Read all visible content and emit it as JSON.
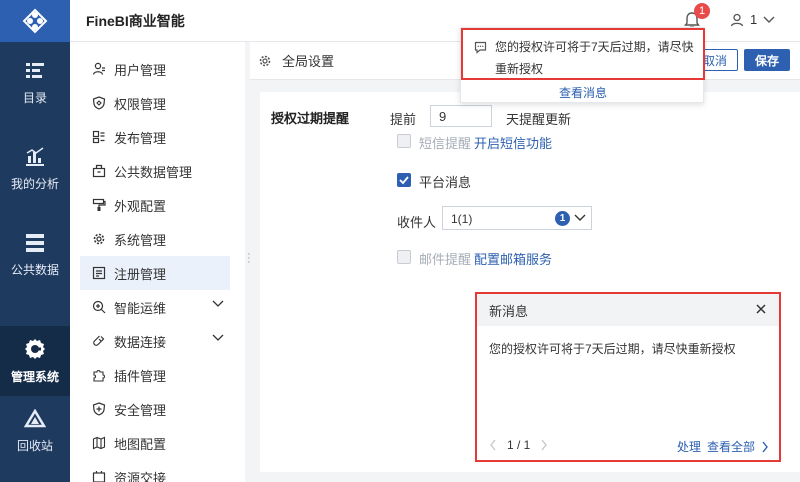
{
  "topbar": {
    "brand": "FineBI商业智能",
    "badge_count": "1",
    "user_name": "1"
  },
  "leftnav": [
    {
      "label": "目录",
      "icon": "catalog-icon"
    },
    {
      "label": "我的分析",
      "icon": "analysis-icon"
    },
    {
      "label": "公共数据",
      "icon": "public-data-icon"
    },
    {
      "label": "管理系统",
      "icon": "gear-icon",
      "active": true
    },
    {
      "label": "回收站",
      "icon": "recycle-icon"
    }
  ],
  "menu": [
    {
      "label": "用户管理",
      "icon": "user-icon"
    },
    {
      "label": "权限管理",
      "icon": "shield-icon"
    },
    {
      "label": "发布管理",
      "icon": "publish-icon"
    },
    {
      "label": "公共数据管理",
      "icon": "box-icon"
    },
    {
      "label": "外观配置",
      "icon": "brush-icon"
    },
    {
      "label": "系统管理",
      "icon": "gear-icon"
    },
    {
      "label": "注册管理",
      "icon": "register-icon",
      "active": true
    },
    {
      "label": "智能运维",
      "icon": "ops-icon",
      "expandable": true
    },
    {
      "label": "数据连接",
      "icon": "link-icon",
      "expandable": true
    },
    {
      "label": "插件管理",
      "icon": "puzzle-icon"
    },
    {
      "label": "安全管理",
      "icon": "security-icon"
    },
    {
      "label": "地图配置",
      "icon": "map-icon"
    },
    {
      "label": "资源交接",
      "icon": "resource-icon"
    }
  ],
  "content": {
    "title": "全局设置",
    "cancel_label": "取消",
    "save_label": "保存",
    "section_label": "授权过期提醒",
    "remind_prefix": "提前",
    "remind_days": "9",
    "remind_suffix": "天提醒更新",
    "sms_label": "短信提醒",
    "sms_link": "开启短信功能",
    "platform_label": "平台消息",
    "receiver_label": "收件人",
    "receiver_value": "1(1)",
    "receiver_count": "1",
    "mail_label": "邮件提醒",
    "mail_link": "配置邮箱服务"
  },
  "tooltip": {
    "message": "您的授权许可将于7天后过期，请尽快重新授权",
    "view_label": "查看消息"
  },
  "newmsg": {
    "title": "新消息",
    "body": "您的授权许可将于7天后过期，请尽快重新授权",
    "page": "1 / 1",
    "handle_label": "处理",
    "view_all_label": "查看全部"
  },
  "colors": {
    "accent": "#2d60b0",
    "nav_bg": "#1f3a5f",
    "highlight": "#e53935"
  }
}
